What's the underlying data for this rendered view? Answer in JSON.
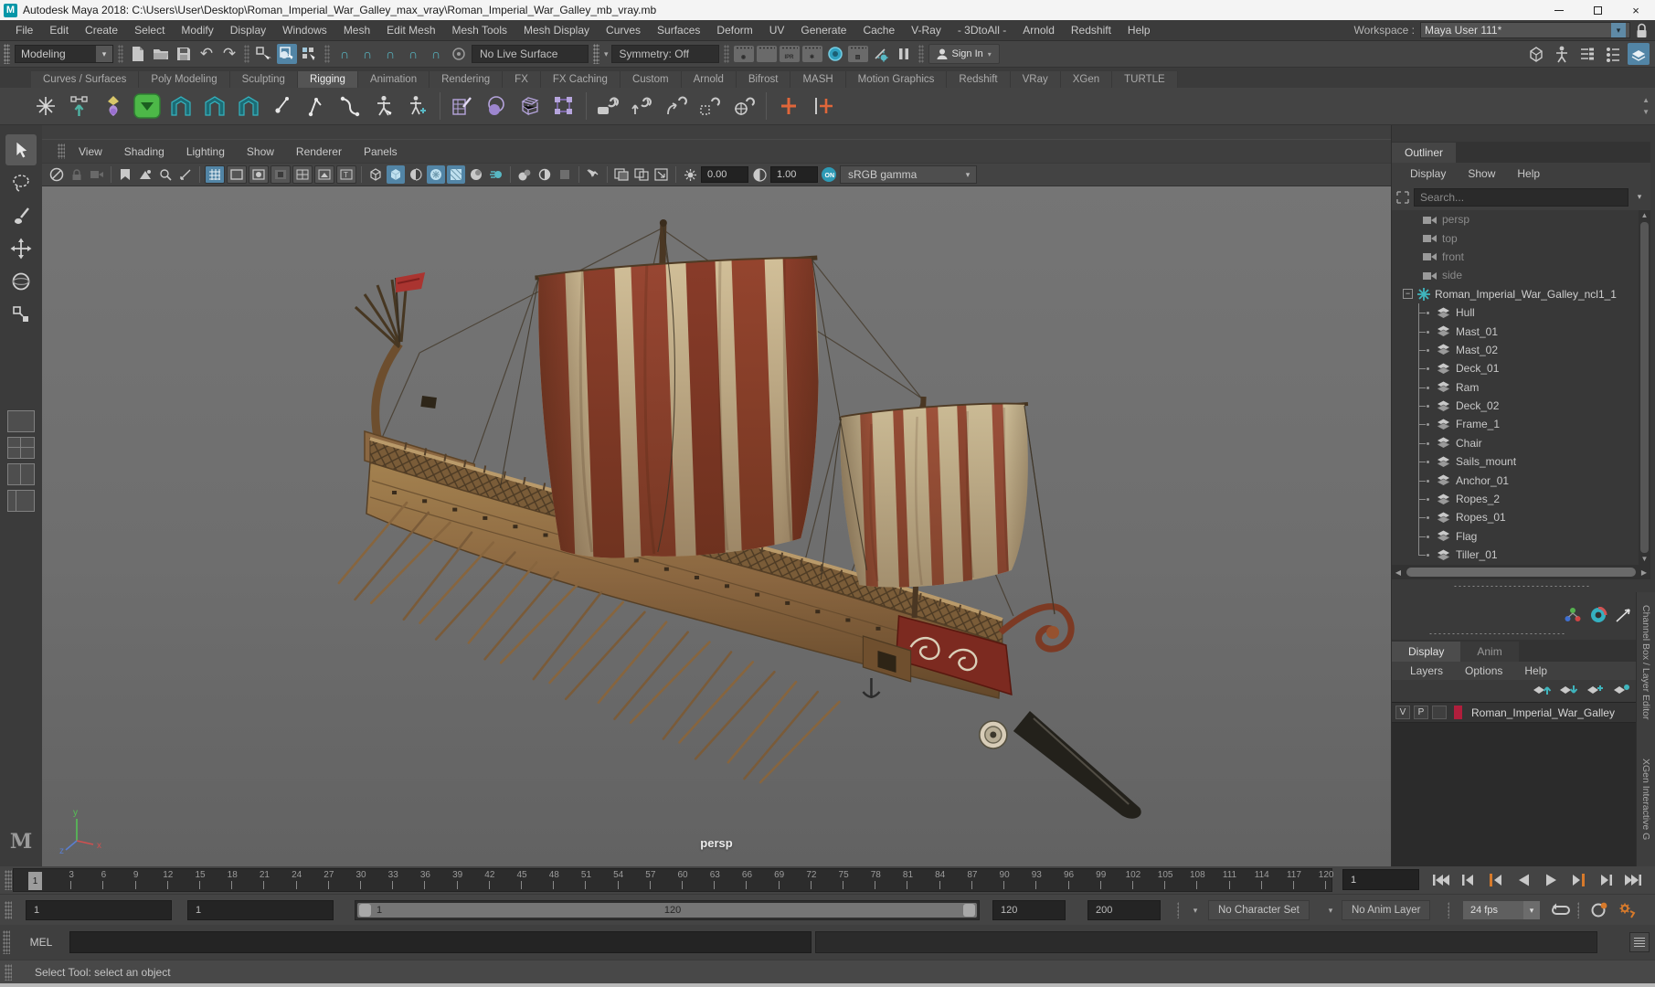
{
  "icons": {
    "caret_down": "▾",
    "undo": "↶",
    "redo": "↷",
    "magnet": "∩",
    "close": "×",
    "left": "◀",
    "right": "▶",
    "up": "▲",
    "down": "▼",
    "minus": "−",
    "plus": "+"
  },
  "window": {
    "app_initial": "M",
    "title": "Autodesk Maya 2018: C:\\Users\\User\\Desktop\\Roman_Imperial_War_Galley_max_vray\\Roman_Imperial_War_Galley_mb_vray.mb"
  },
  "menu_bar": {
    "items": [
      "File",
      "Edit",
      "Create",
      "Select",
      "Modify",
      "Display",
      "Windows",
      "Mesh",
      "Edit Mesh",
      "Mesh Tools",
      "Mesh Display",
      "Curves",
      "Surfaces",
      "Deform",
      "UV",
      "Generate",
      "Cache",
      "V-Ray",
      "- 3DtoAll -",
      "Arnold",
      "Redshift",
      "Help"
    ],
    "workspace_label": "Workspace :",
    "workspace_value": "Maya User 111*"
  },
  "status_line": {
    "menuset": "Modeling",
    "live_surface": "No Live Surface",
    "symmetry": "Symmetry: Off",
    "ipr": "IPR",
    "sign_in": "Sign In"
  },
  "shelf": {
    "tabs": [
      "Curves / Surfaces",
      "Poly Modeling",
      "Sculpting",
      "Rigging",
      "Animation",
      "Rendering",
      "FX",
      "FX Caching",
      "Custom",
      "Arnold",
      "Bifrost",
      "MASH",
      "Motion Graphics",
      "Redshift",
      "VRay",
      "XGen",
      "TURTLE"
    ],
    "active_tab": "Rigging"
  },
  "viewport": {
    "menu": [
      "View",
      "Shading",
      "Lighting",
      "Show",
      "Renderer",
      "Panels"
    ],
    "exposure": "0.00",
    "gamma": "1.00",
    "colorspace": "sRGB gamma",
    "camera_label": "persp",
    "axis": {
      "x": "x",
      "y": "y",
      "z": "z"
    }
  },
  "outliner": {
    "tab": "Outliner",
    "menus": [
      "Display",
      "Show",
      "Help"
    ],
    "search_placeholder": "Search...",
    "cameras": [
      "persp",
      "top",
      "front",
      "side"
    ],
    "root_item": "Roman_Imperial_War_Galley_ncl1_1",
    "children": [
      "Hull",
      "Mast_01",
      "Mast_02",
      "Deck_01",
      "Ram",
      "Deck_02",
      "Frame_1",
      "Chair",
      "Sails_mount",
      "Anchor_01",
      "Ropes_2",
      "Ropes_01",
      "Flag",
      "Tiller_01"
    ]
  },
  "layer_editor": {
    "tabs": [
      "Display",
      "Anim"
    ],
    "active_tab": "Display",
    "menus": [
      "Layers",
      "Options",
      "Help"
    ],
    "layer": {
      "visible": "V",
      "playback": "P",
      "name": "Roman_Imperial_War_Galley",
      "color": "#b01e3c"
    },
    "side_tab": "Channel Box / Layer Editor",
    "side_tab_2": "XGen Interactive G"
  },
  "timeline": {
    "ticks": [
      "3",
      "6",
      "9",
      "12",
      "15",
      "18",
      "21",
      "24",
      "27",
      "30",
      "33",
      "36",
      "39",
      "42",
      "45",
      "48",
      "51",
      "54",
      "57",
      "60",
      "63",
      "66",
      "69",
      "72",
      "75",
      "78",
      "81",
      "84",
      "87",
      "90",
      "93",
      "96",
      "99",
      "102",
      "105",
      "108",
      "111",
      "114",
      "117",
      "120"
    ],
    "current_marker": "1",
    "current_field": "1"
  },
  "range": {
    "anim_start": "1",
    "playback_start": "1",
    "slider_start": "1",
    "slider_end": "120",
    "playback_end": "120",
    "anim_end": "200",
    "character_set": "No Character Set",
    "anim_layer": "No Anim Layer",
    "fps": "24 fps"
  },
  "command_line": {
    "label": "MEL"
  },
  "help_line": {
    "text": "Select Tool: select an object"
  }
}
